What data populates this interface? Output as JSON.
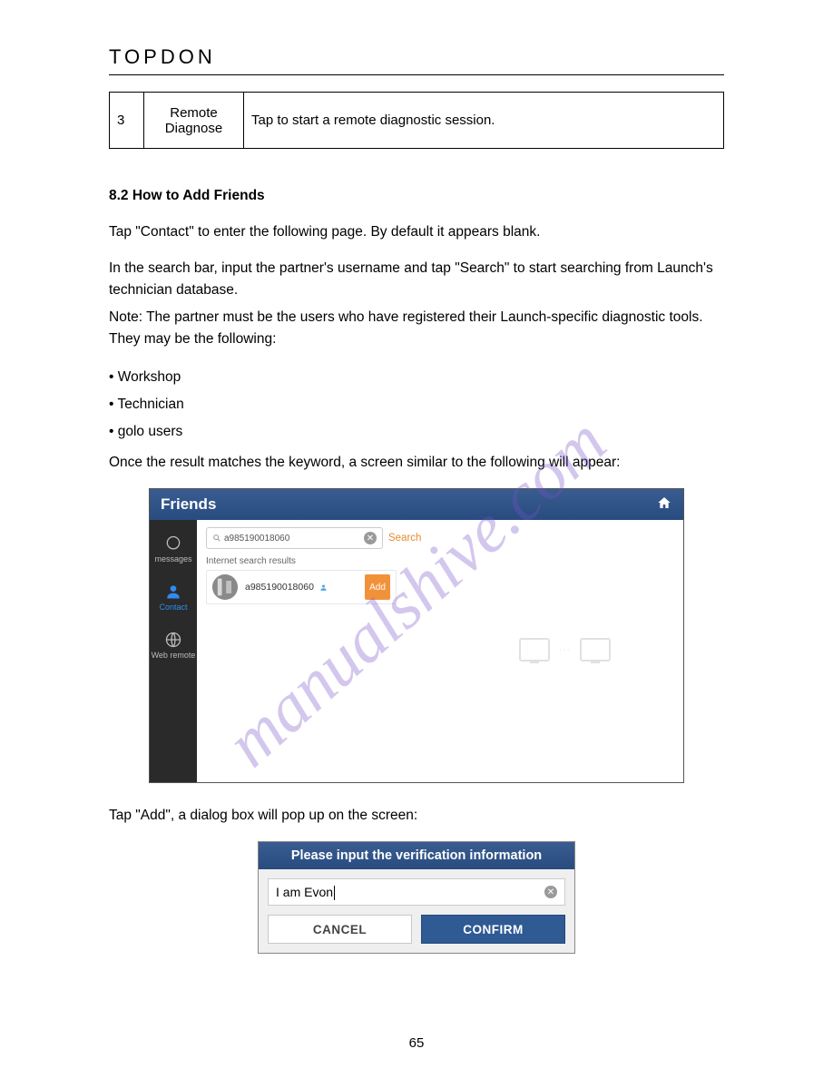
{
  "logo_text": "TOPDON",
  "watermark": "manualshive.com",
  "page_number": "65",
  "table_row": {
    "num": "3",
    "label": "Remote Diagnose",
    "desc": "Tap to start a remote diagnostic session."
  },
  "section_heading": "8.2 How to Add Friends",
  "para_tap_contact": "Tap \"Contact\" to enter the following page. By default it appears blank.",
  "para_search_bar": "In the search bar, input the partner's username and tap \"Search\" to start searching from Launch's technician database.",
  "note_text": "Note: The partner must be the users who have registered their Launch-specific diagnostic tools. They may be the following:",
  "bullets": [
    "Workshop",
    "Technician",
    "golo users"
  ],
  "para_once_result": "Once the result matches the keyword, a screen similar to the following will appear:",
  "friends": {
    "title": "Friends",
    "search_value": "a985190018060",
    "search_link": "Search",
    "results_label": "Internet search results",
    "result_username": "a985190018060",
    "add_label": "Add",
    "sidebar": {
      "messages": "messages",
      "contact": "Contact",
      "web_remote": "Web remote"
    }
  },
  "para_tap_add": "Tap \"Add\", a dialog box will pop up on the screen:",
  "verify": {
    "header": "Please input the verification information",
    "input_value": "I am Evon",
    "cancel": "CANCEL",
    "confirm": "CONFIRM"
  }
}
